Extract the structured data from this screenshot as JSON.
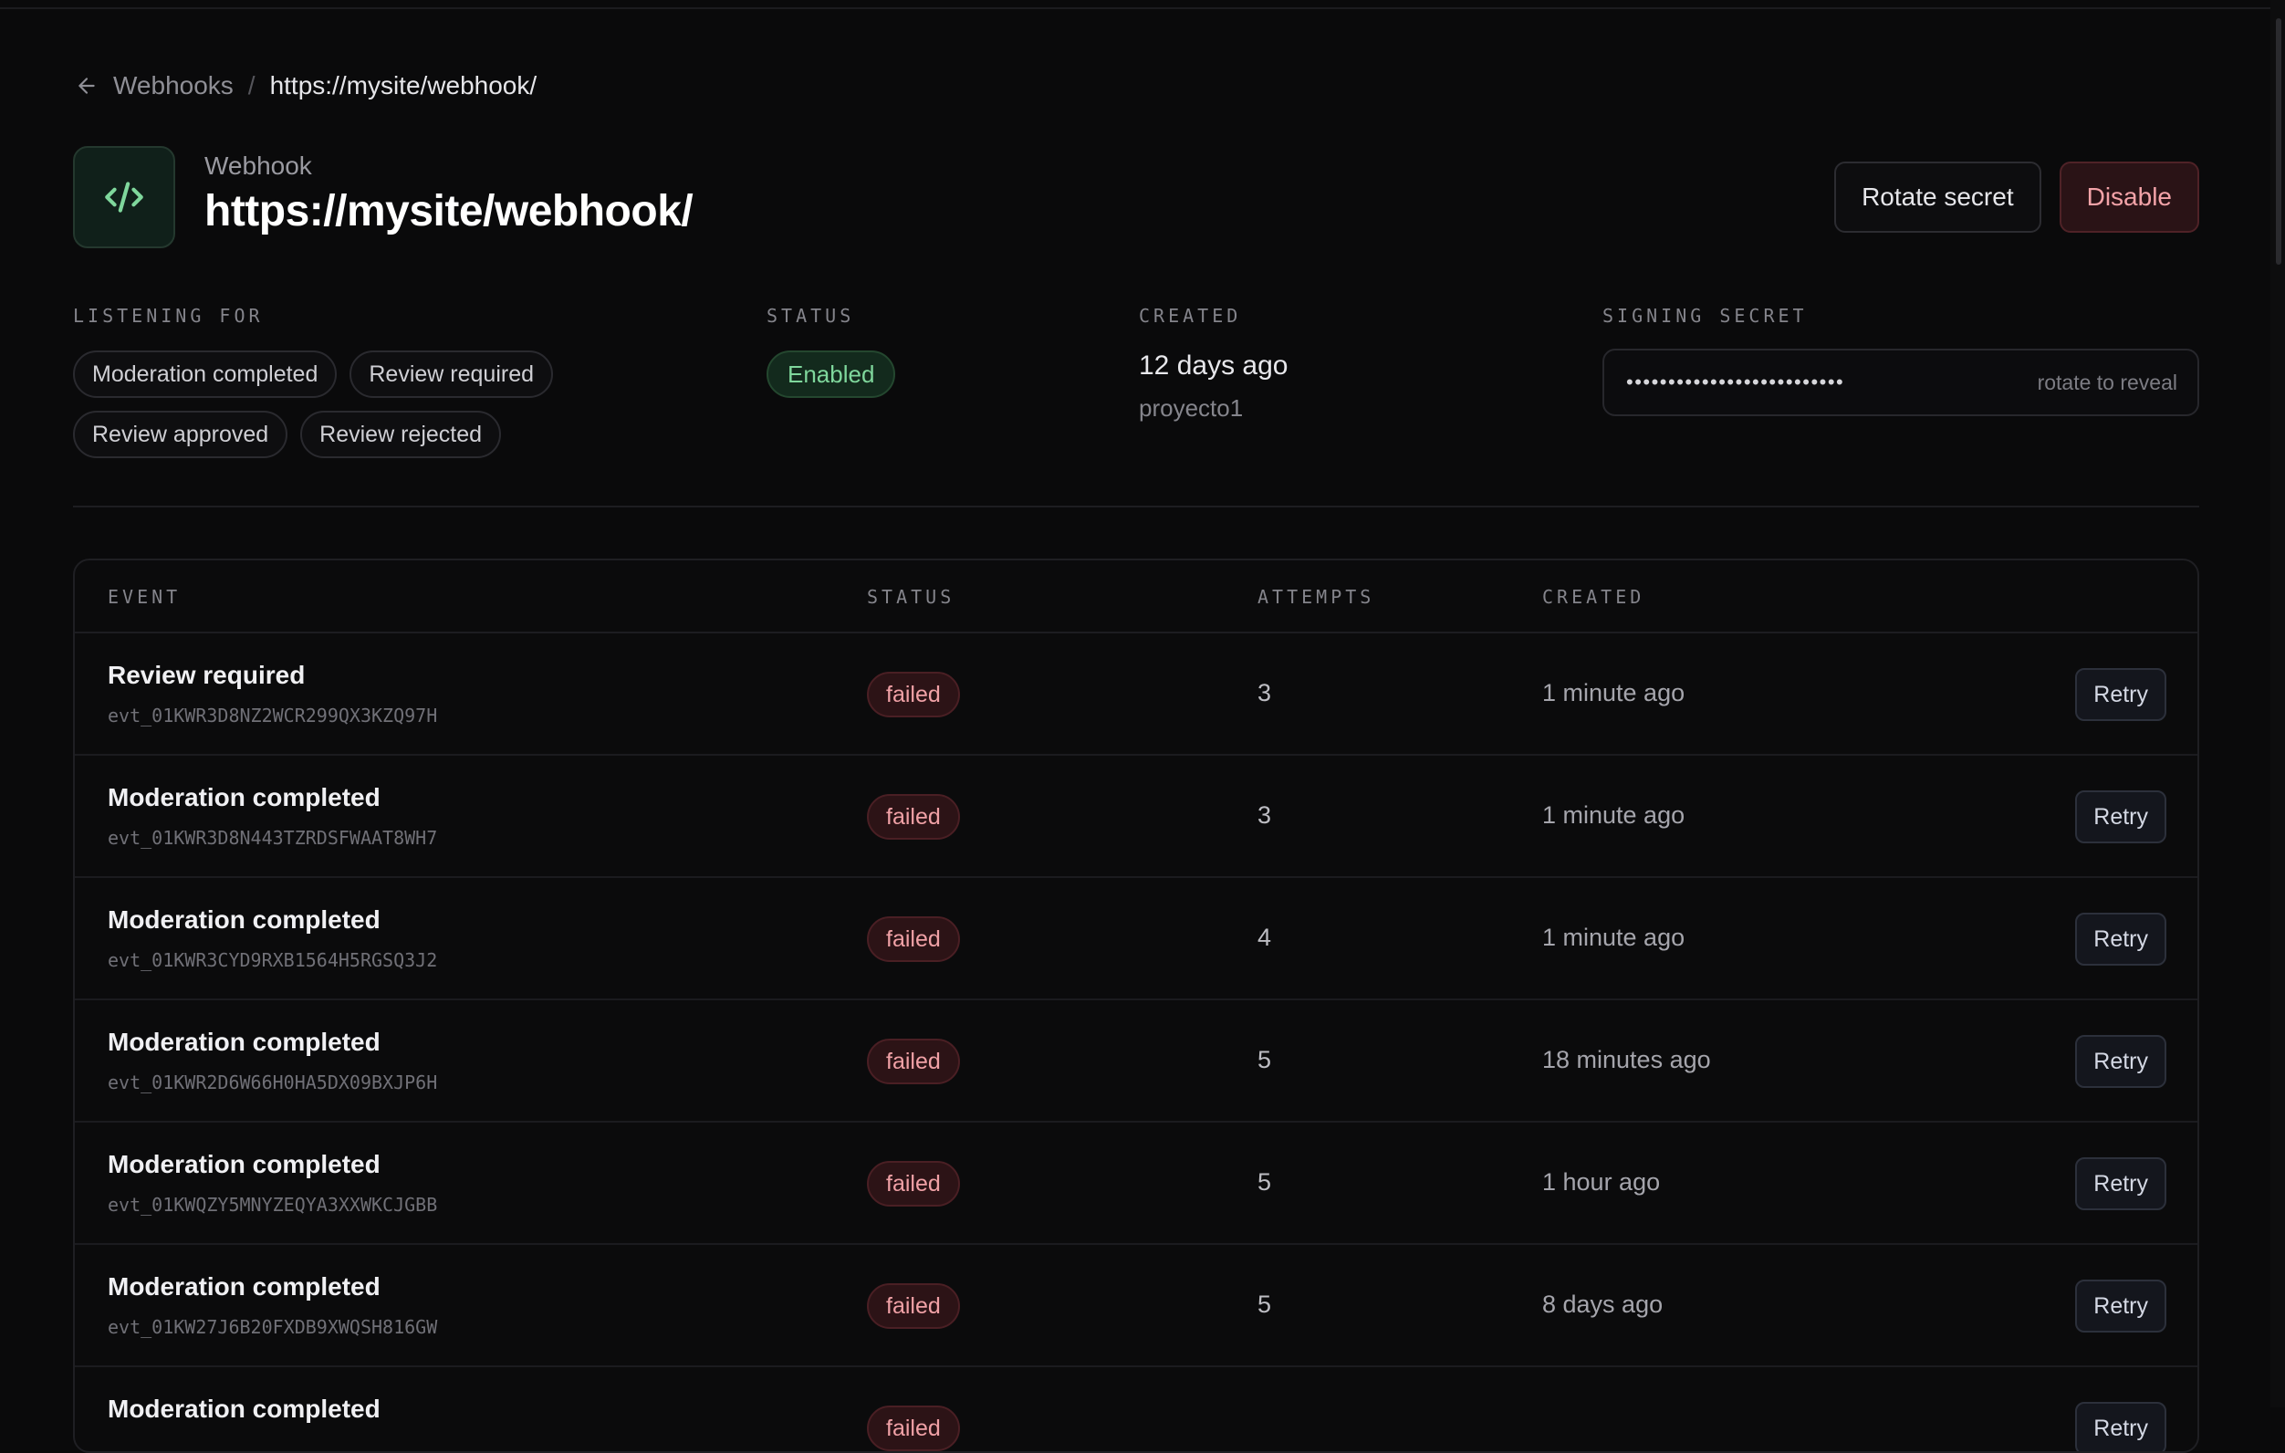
{
  "breadcrumb": {
    "parent": "Webhooks",
    "separator": "/",
    "current": "https://mysite/webhook/"
  },
  "header": {
    "kicker": "Webhook",
    "title": "https://mysite/webhook/",
    "icon": "code-icon",
    "actions": {
      "rotate_label": "Rotate secret",
      "disable_label": "Disable"
    }
  },
  "meta": {
    "listening_label": "LISTENING FOR",
    "listening": [
      "Moderation completed",
      "Review required",
      "Review approved",
      "Review rejected"
    ],
    "status_label": "STATUS",
    "status_value": "Enabled",
    "created_label": "CREATED",
    "created_when": "12 days ago",
    "created_by": "proyecto1",
    "secret_label": "SIGNING SECRET",
    "secret_mask": "••••••••••••••••••••••••••",
    "secret_hint": "rotate to reveal"
  },
  "table": {
    "columns": [
      "EVENT",
      "STATUS",
      "ATTEMPTS",
      "CREATED"
    ],
    "retry_label": "Retry",
    "rows": [
      {
        "event": "Review required",
        "id": "evt_01KWR3D8NZ2WCR299QX3KZQ97H",
        "status": "failed",
        "attempts": "3",
        "created": "1 minute ago"
      },
      {
        "event": "Moderation completed",
        "id": "evt_01KWR3D8N443TZRDSFWAAT8WH7",
        "status": "failed",
        "attempts": "3",
        "created": "1 minute ago"
      },
      {
        "event": "Moderation completed",
        "id": "evt_01KWR3CYD9RXB1564H5RGSQ3J2",
        "status": "failed",
        "attempts": "4",
        "created": "1 minute ago"
      },
      {
        "event": "Moderation completed",
        "id": "evt_01KWR2D6W66H0HA5DX09BXJP6H",
        "status": "failed",
        "attempts": "5",
        "created": "18 minutes ago"
      },
      {
        "event": "Moderation completed",
        "id": "evt_01KWQZY5MNYZEQYA3XXWKCJGBB",
        "status": "failed",
        "attempts": "5",
        "created": "1 hour ago"
      },
      {
        "event": "Moderation completed",
        "id": "evt_01KW27J6B20FXDB9XWQSH816GW",
        "status": "failed",
        "attempts": "5",
        "created": "8 days ago"
      },
      {
        "event": "Moderation completed",
        "id": "",
        "status": "failed",
        "attempts": "",
        "created": ""
      }
    ]
  },
  "colors": {
    "background": "#0a0a0b",
    "accent_green": "#7fd79c",
    "danger": "#f0a1a6"
  }
}
